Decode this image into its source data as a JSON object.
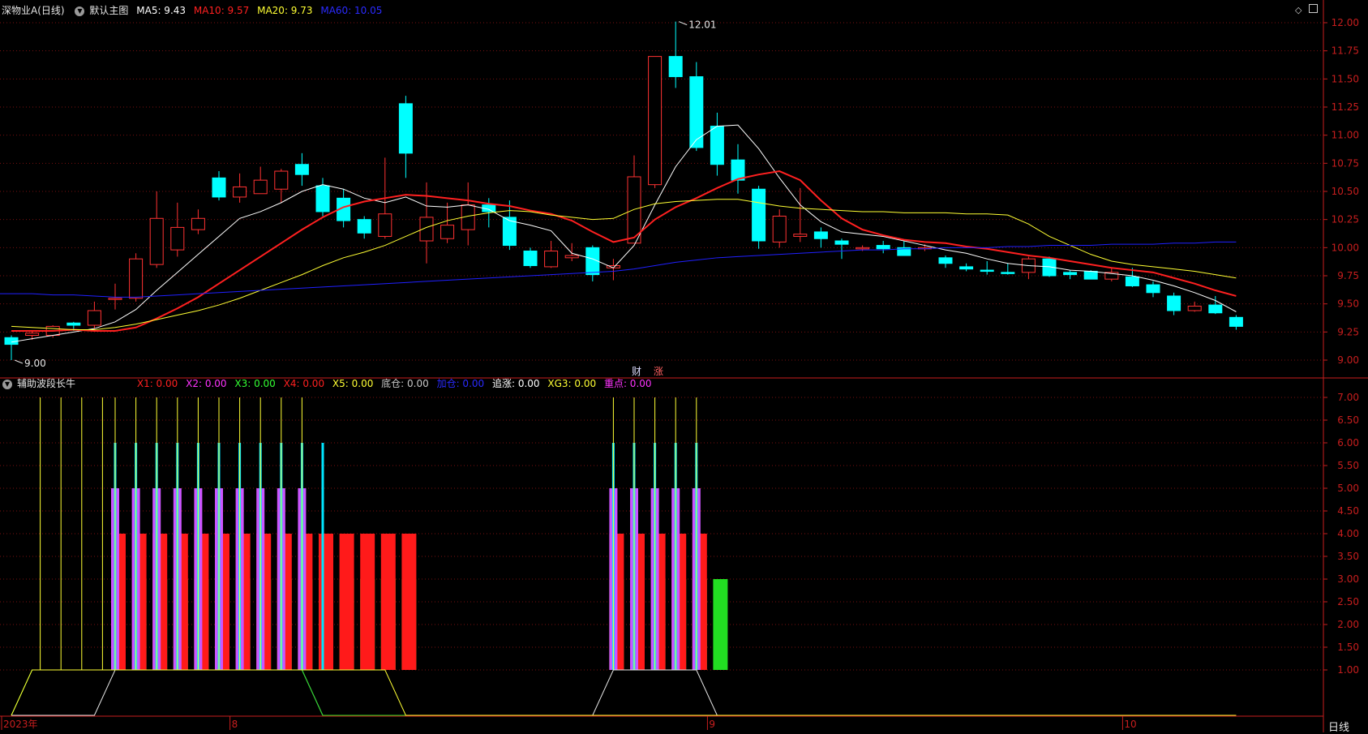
{
  "main_header": {
    "stock_name": "深物业A(日线)",
    "chart_mode": "默认主图",
    "ma5": "MA5: 9.43",
    "ma10": "MA10: 9.57",
    "ma20": "MA20: 9.73",
    "ma60": "MA60: 10.05"
  },
  "sub_header": {
    "indicator": "辅助波段长牛",
    "x1": "X1: 0.00",
    "x2": "X2: 0.00",
    "x3": "X3: 0.00",
    "x4": "X4: 0.00",
    "x5": "X5: 0.00",
    "dicang": "底仓: 0.00",
    "jiacang": "加仓: 0.00",
    "zhuizhang": "追涨: 0.00",
    "xg3": "XG3: 0.00",
    "zhongdian": "重点: 0.00"
  },
  "markers": {
    "cai": "财",
    "zhang": "涨"
  },
  "footer": {
    "period": "日线"
  },
  "colors": {
    "up": "#ff3232",
    "down": "#00ffff",
    "ma5": "#ffffff",
    "ma10": "#ff2020",
    "ma20": "#ffff33",
    "ma60": "#2020ff",
    "grid": "#7a1010",
    "axis": "#c81e1e"
  },
  "icons": [
    "collapse-circle-icon",
    "diamond-icon",
    "window-toggle-icon"
  ],
  "chart_data": [
    {
      "type": "candlestick",
      "title": "深物业A(日线)",
      "ylim": [
        8.9,
        12.1
      ],
      "y_ticks": [
        9.0,
        9.25,
        9.5,
        9.75,
        10.0,
        10.25,
        10.5,
        10.75,
        11.0,
        11.25,
        11.5,
        11.75,
        12.0
      ],
      "x_ticks": [
        {
          "i": 0,
          "label": "2023年"
        },
        {
          "i": 11,
          "label": "8"
        },
        {
          "i": 34,
          "label": "9"
        },
        {
          "i": 54,
          "label": "10"
        }
      ],
      "annotations": [
        {
          "i": 0,
          "value": 9.0,
          "label": "9.00"
        },
        {
          "i": 32,
          "value": 12.01,
          "label": "12.01"
        }
      ],
      "ohlc": [
        [
          9.2,
          9.14,
          9.22,
          9.0
        ],
        [
          9.22,
          9.24,
          9.26,
          9.18
        ],
        [
          9.22,
          9.3,
          9.31,
          9.2
        ],
        [
          9.33,
          9.31,
          9.34,
          9.26
        ],
        [
          9.31,
          9.44,
          9.52,
          9.28
        ],
        [
          9.55,
          9.55,
          9.68,
          9.45
        ],
        [
          9.55,
          9.9,
          9.95,
          9.52
        ],
        [
          9.85,
          10.26,
          10.5,
          9.82
        ],
        [
          9.98,
          10.18,
          10.4,
          9.92
        ],
        [
          10.16,
          10.26,
          10.34,
          10.12
        ],
        [
          10.62,
          10.45,
          10.68,
          10.42
        ],
        [
          10.45,
          10.54,
          10.66,
          10.4
        ],
        [
          10.48,
          10.6,
          10.72,
          10.48
        ],
        [
          10.52,
          10.68,
          10.7,
          10.4
        ],
        [
          10.74,
          10.65,
          10.84,
          10.55
        ],
        [
          10.55,
          10.32,
          10.62,
          10.28
        ],
        [
          10.44,
          10.24,
          10.52,
          10.18
        ],
        [
          10.25,
          10.13,
          10.28,
          10.08
        ],
        [
          10.1,
          10.3,
          10.8,
          10.08
        ],
        [
          11.28,
          10.84,
          11.35,
          10.62
        ],
        [
          10.06,
          10.27,
          10.58,
          9.86
        ],
        [
          10.08,
          10.2,
          10.4,
          10.04
        ],
        [
          10.16,
          10.38,
          10.58,
          10.02
        ],
        [
          10.38,
          10.32,
          10.44,
          10.18
        ],
        [
          10.27,
          10.02,
          10.42,
          9.98
        ],
        [
          9.97,
          9.84,
          10.0,
          9.82
        ],
        [
          9.83,
          9.97,
          10.06,
          9.82
        ],
        [
          9.91,
          9.93,
          10.04,
          9.88
        ],
        [
          10.0,
          9.76,
          10.02,
          9.7
        ],
        [
          9.82,
          9.84,
          9.9,
          9.71
        ],
        [
          10.04,
          10.63,
          10.82,
          10.04
        ],
        [
          10.56,
          11.7,
          11.7,
          10.53
        ],
        [
          11.7,
          11.52,
          12.01,
          11.42
        ],
        [
          11.52,
          10.89,
          11.65,
          10.86
        ],
        [
          11.08,
          10.74,
          11.2,
          10.64
        ],
        [
          10.78,
          10.6,
          10.92,
          10.48
        ],
        [
          10.52,
          10.06,
          10.55,
          9.99
        ],
        [
          10.05,
          10.28,
          10.34,
          10.0
        ],
        [
          10.1,
          10.12,
          10.53,
          10.05
        ],
        [
          10.14,
          10.08,
          10.18,
          10.0
        ],
        [
          10.06,
          10.03,
          10.08,
          9.9
        ],
        [
          10.0,
          10.0,
          10.02,
          9.97
        ],
        [
          10.02,
          9.99,
          10.06,
          9.95
        ],
        [
          10.0,
          9.93,
          10.06,
          9.93
        ],
        [
          9.99,
          10.0,
          10.03,
          9.97
        ],
        [
          9.91,
          9.86,
          9.93,
          9.82
        ],
        [
          9.83,
          9.81,
          9.86,
          9.79
        ],
        [
          9.8,
          9.79,
          9.88,
          9.76
        ],
        [
          9.78,
          9.77,
          9.86,
          9.76
        ],
        [
          9.78,
          9.9,
          9.92,
          9.72
        ],
        [
          9.9,
          9.75,
          9.92,
          9.74
        ],
        [
          9.78,
          9.76,
          9.8,
          9.72
        ],
        [
          9.79,
          9.72,
          9.8,
          9.72
        ],
        [
          9.72,
          9.78,
          9.82,
          9.7
        ],
        [
          9.74,
          9.66,
          9.82,
          9.65
        ],
        [
          9.67,
          9.6,
          9.7,
          9.56
        ],
        [
          9.57,
          9.44,
          9.6,
          9.4
        ],
        [
          9.44,
          9.48,
          9.52,
          9.43
        ],
        [
          9.49,
          9.42,
          9.57,
          9.41
        ],
        [
          9.38,
          9.3,
          9.4,
          9.27
        ]
      ],
      "series": [
        {
          "name": "MA5",
          "values": [
            9.16,
            9.19,
            9.22,
            9.25,
            9.28,
            9.34,
            9.45,
            9.62,
            9.78,
            9.94,
            10.1,
            10.26,
            10.32,
            10.4,
            10.5,
            10.56,
            10.52,
            10.44,
            10.4,
            10.45,
            10.37,
            10.36,
            10.38,
            10.34,
            10.24,
            10.2,
            10.15,
            9.95,
            9.9,
            9.82,
            10.02,
            10.38,
            10.72,
            10.96,
            11.08,
            11.09,
            10.88,
            10.62,
            10.38,
            10.23,
            10.14,
            10.12,
            10.1,
            10.06,
            10.02,
            9.98,
            9.95,
            9.9,
            9.86,
            9.84,
            9.83,
            9.8,
            9.79,
            9.77,
            9.75,
            9.71,
            9.66,
            9.6,
            9.53,
            9.43
          ]
        },
        {
          "name": "MA10",
          "values": [
            9.26,
            9.26,
            9.26,
            9.27,
            9.26,
            9.26,
            9.29,
            9.37,
            9.46,
            9.56,
            9.68,
            9.8,
            9.92,
            10.04,
            10.16,
            10.27,
            10.36,
            10.41,
            10.44,
            10.47,
            10.46,
            10.44,
            10.42,
            10.39,
            10.37,
            10.33,
            10.3,
            10.24,
            10.14,
            10.05,
            10.09,
            10.25,
            10.36,
            10.44,
            10.53,
            10.61,
            10.65,
            10.68,
            10.6,
            10.42,
            10.26,
            10.16,
            10.11,
            10.07,
            10.05,
            10.04,
            10.01,
            9.99,
            9.96,
            9.93,
            9.91,
            9.88,
            9.85,
            9.82,
            9.8,
            9.78,
            9.73,
            9.68,
            9.62,
            9.57
          ]
        },
        {
          "name": "MA20",
          "values": [
            9.3,
            9.29,
            9.28,
            9.27,
            9.27,
            9.29,
            9.32,
            9.36,
            9.4,
            9.44,
            9.49,
            9.55,
            9.62,
            9.69,
            9.76,
            9.84,
            9.91,
            9.96,
            10.02,
            10.1,
            10.18,
            10.24,
            10.28,
            10.31,
            10.33,
            10.32,
            10.29,
            10.27,
            10.25,
            10.26,
            10.34,
            10.39,
            10.41,
            10.42,
            10.43,
            10.43,
            10.4,
            10.37,
            10.35,
            10.34,
            10.33,
            10.32,
            10.32,
            10.31,
            10.31,
            10.31,
            10.3,
            10.3,
            10.29,
            10.21,
            10.1,
            10.02,
            9.94,
            9.88,
            9.85,
            9.83,
            9.81,
            9.79,
            9.76,
            9.73
          ]
        },
        {
          "name": "MA60",
          "values": [
            9.59,
            9.59,
            9.58,
            9.58,
            9.57,
            9.56,
            9.56,
            9.57,
            9.58,
            9.59,
            9.6,
            9.61,
            9.62,
            9.63,
            9.64,
            9.65,
            9.66,
            9.67,
            9.68,
            9.69,
            9.7,
            9.71,
            9.72,
            9.73,
            9.74,
            9.75,
            9.76,
            9.77,
            9.78,
            9.79,
            9.81,
            9.84,
            9.87,
            9.89,
            9.91,
            9.92,
            9.93,
            9.94,
            9.95,
            9.96,
            9.97,
            9.98,
            9.98,
            9.99,
            9.99,
            10.0,
            10.0,
            10.0,
            10.01,
            10.01,
            10.02,
            10.02,
            10.02,
            10.03,
            10.03,
            10.03,
            10.04,
            10.04,
            10.05,
            10.05
          ]
        }
      ]
    },
    {
      "type": "bar",
      "title": "辅助波段长牛",
      "ylim": [
        0,
        7.2
      ],
      "y_ticks": [
        1.0,
        1.5,
        2.0,
        2.5,
        3.0,
        3.5,
        4.0,
        4.5,
        5.0,
        5.5,
        6.0,
        6.5,
        7.0
      ],
      "green_bars_value": 3,
      "green_bars_days": [
        5,
        6,
        7,
        8,
        9,
        10,
        11,
        12,
        13,
        14,
        15,
        16,
        17,
        18,
        19,
        29,
        30,
        31,
        32,
        33,
        34
      ],
      "red_bars_value": 4,
      "red_bars_days": [
        5,
        6,
        7,
        8,
        9,
        10,
        11,
        12,
        13,
        14,
        15,
        16,
        17,
        18,
        19,
        29,
        30,
        31,
        32,
        33
      ],
      "magenta_bars_value": 5,
      "magenta_bars_days": [
        5,
        6,
        7,
        8,
        9,
        10,
        11,
        12,
        13,
        14,
        29,
        30,
        31,
        32,
        33
      ],
      "cyan_lines_value": 6,
      "cyan_lines_days": [
        5,
        6,
        7,
        8,
        9,
        10,
        11,
        12,
        13,
        14,
        15,
        29,
        30,
        31,
        32,
        33
      ],
      "yellow_lines_value": 7,
      "yellow_lines_days": [
        1,
        2,
        3,
        4,
        5,
        6,
        7,
        8,
        9,
        10,
        11,
        12,
        13,
        14,
        29,
        30,
        31,
        32,
        33
      ],
      "white_line": [
        0,
        0,
        0,
        0,
        0,
        1,
        1,
        1,
        1,
        1,
        1,
        1,
        1,
        1,
        1,
        0,
        0,
        0,
        0,
        0,
        0,
        0,
        0,
        0,
        0,
        0,
        0,
        0,
        0,
        1,
        1,
        1,
        1,
        1,
        0,
        0,
        0,
        0,
        0,
        0,
        0,
        0,
        0,
        0,
        0,
        0,
        0,
        0,
        0,
        0,
        0,
        0,
        0,
        0,
        0,
        0,
        0,
        0,
        0,
        0
      ],
      "green_line": [
        0,
        1,
        1,
        1,
        1,
        1,
        1,
        1,
        1,
        1,
        1,
        1,
        1,
        1,
        1,
        0,
        0,
        0,
        0,
        0,
        0,
        0,
        0,
        0,
        0,
        0,
        0,
        0,
        0,
        0,
        0,
        0,
        0,
        0,
        0,
        0,
        0,
        0,
        0,
        0,
        0,
        0,
        0,
        0,
        0,
        0,
        0,
        0,
        0,
        0,
        0,
        0,
        0,
        0,
        0,
        0,
        0,
        0,
        0,
        0
      ],
      "yellow_line": [
        0,
        1,
        1,
        1,
        1,
        1,
        1,
        1,
        1,
        1,
        1,
        1,
        1,
        1,
        1,
        1,
        1,
        1,
        1,
        0,
        0,
        0,
        0,
        0,
        0,
        0,
        0,
        0,
        0,
        0,
        0,
        0,
        0,
        0,
        0,
        0,
        0,
        0,
        0,
        0,
        0,
        0,
        0,
        0,
        0,
        0,
        0,
        0,
        0,
        0,
        0,
        0,
        0,
        0,
        0,
        0,
        0,
        0,
        0,
        0
      ]
    }
  ]
}
